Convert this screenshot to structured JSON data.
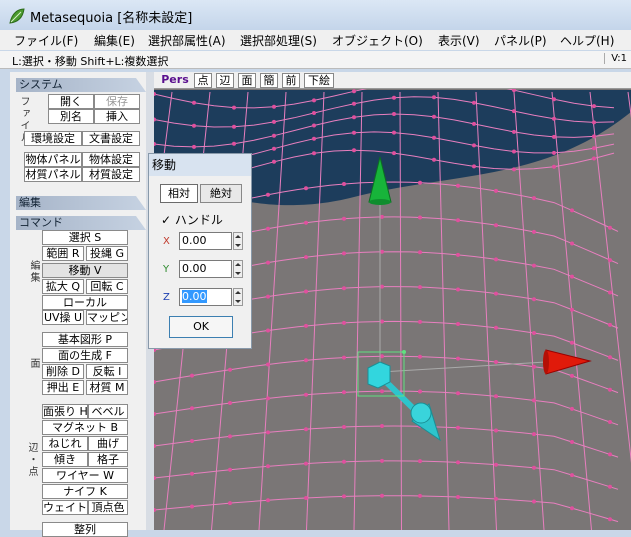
{
  "window": {
    "title": "Metasequoia [名称未設定]"
  },
  "menu": [
    {
      "label": "ファイル(F)"
    },
    {
      "label": "編集(E)"
    },
    {
      "label": "選択部属性(A)"
    },
    {
      "label": "選択部処理(S)"
    },
    {
      "label": "オブジェクト(O)"
    },
    {
      "label": "表示(V)"
    },
    {
      "label": "パネル(P)"
    },
    {
      "label": "ヘルプ(H)"
    }
  ],
  "status": {
    "text": "L:選択・移動  Shift+L:複数選択",
    "version": "V:1"
  },
  "panel": {
    "system_head": "システム",
    "file_label": "ファイル",
    "file_buttons": [
      "開く",
      "保存",
      "別名",
      "挿入"
    ],
    "system_buttons": [
      "環境設定",
      "文書設定",
      "物体パネル",
      "物体設定",
      "材質パネル",
      "材質設定"
    ],
    "edit_head": "編集",
    "command_head": "コマンド",
    "edit_label": "編集",
    "edit_buttons": [
      "選択 S",
      "範囲 R",
      "投縄 G",
      "移動 V",
      "拡大 Q",
      "回転 C",
      "ローカル",
      "UV操 U",
      "マッピング"
    ],
    "face_label": "面",
    "face_buttons": [
      "基本図形 P",
      "面の生成 F",
      "削除 D",
      "反転 I",
      "押出 E",
      "材質 M"
    ],
    "edgepoint_label": "辺・点",
    "edgepoint_buttons": [
      "面張り H",
      "ベベル",
      "マグネット B",
      "ねじれ",
      "曲げ",
      "傾き",
      "格子",
      "ワイヤー W",
      "ナイフ K",
      "ウェイト",
      "頂点色",
      "整列"
    ]
  },
  "viewport": {
    "toolbar": [
      "Pers",
      "点",
      "辺",
      "面",
      "簡",
      "前",
      "下絵"
    ],
    "colors": {
      "bg": "#7a7676",
      "dark": "#1d3d5c",
      "wire": "#e87fbf",
      "point": "#e0509e",
      "green": "#17b43a",
      "red": "#e01a0a",
      "cyan": "#2ec4cc"
    }
  },
  "dialog": {
    "title": "移動",
    "tabs": [
      "相対",
      "絶対"
    ],
    "handle_label": "ハンドル",
    "handle_checked": "✓",
    "fields": [
      {
        "axis": "X",
        "value": "0.00"
      },
      {
        "axis": "Y",
        "value": "0.00"
      },
      {
        "axis": "Z",
        "value": "0.00"
      }
    ],
    "ok_label": "OK"
  }
}
